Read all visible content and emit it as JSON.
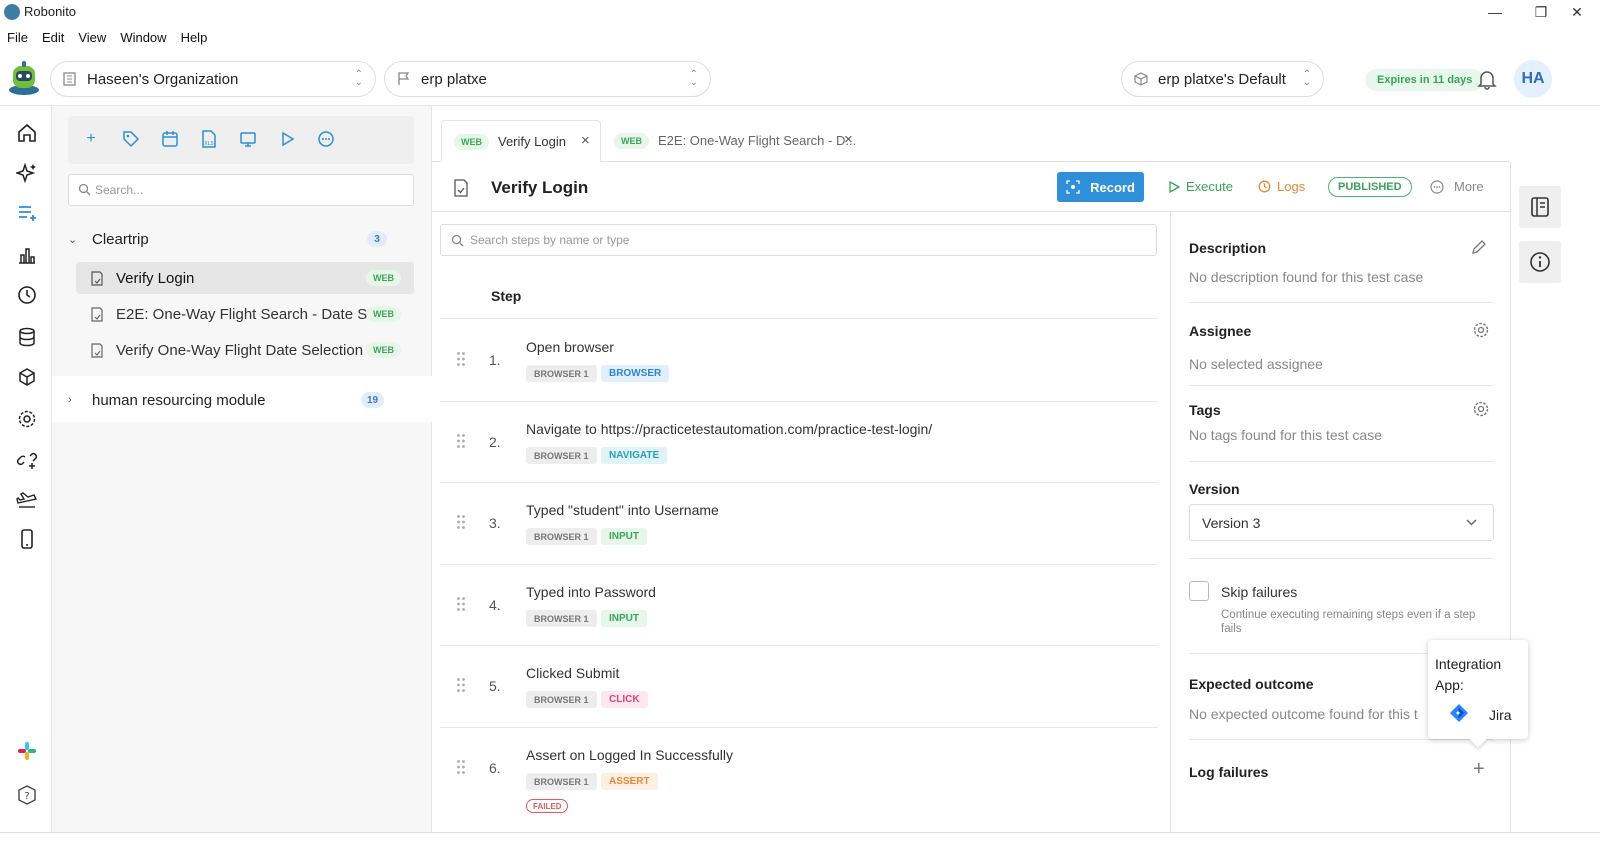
{
  "window": {
    "title": "Robonito",
    "minimize": "—",
    "maximize": "❐",
    "close": "✕"
  },
  "menu": [
    "File",
    "Edit",
    "View",
    "Window",
    "Help"
  ],
  "header": {
    "organization": "Haseen's Organization",
    "project": "erp platxe",
    "environment": "erp platxe's Default",
    "expires": "Expires in 11 days",
    "avatar": "HA"
  },
  "rail_icons": [
    "home-icon",
    "sparkle-icon",
    "test-cases-icon",
    "chart-icon",
    "clock-icon",
    "database-icon",
    "cube-icon",
    "settings-icon",
    "integrations-icon",
    "plane-icon",
    "mobile-icon",
    "slack-icon",
    "help-icon"
  ],
  "tree": {
    "search_placeholder": "Search...",
    "toolbar_icons": [
      "plus-icon",
      "tag-icon",
      "calendar-icon",
      "file-xls-icon",
      "monitor-icon",
      "play-icon",
      "more-icon"
    ],
    "groups": [
      {
        "name": "Cleartrip",
        "count": "3",
        "expanded": true,
        "items": [
          {
            "name": "Verify Login",
            "tag": "WEB",
            "selected": true
          },
          {
            "name": "E2E: One-Way Flight Search - Date S...",
            "tag": "WEB",
            "selected": false
          },
          {
            "name": "Verify One-Way Flight Date Selection",
            "tag": "WEB",
            "selected": false
          }
        ]
      },
      {
        "name": "human resourcing module",
        "count": "19",
        "expanded": false
      }
    ]
  },
  "tabs": [
    {
      "tag": "WEB",
      "label": "Verify Login",
      "active": true
    },
    {
      "tag": "WEB",
      "label": "E2E: One-Way Flight Search - D...",
      "active": false
    }
  ],
  "test_case": {
    "title": "Verify Login",
    "record": "Record",
    "execute": "Execute",
    "logs": "Logs",
    "status": "PUBLISHED",
    "more": "More"
  },
  "steps": {
    "search_placeholder": "Search steps by name or type",
    "header": "Step",
    "items": [
      {
        "num": "1.",
        "title": "Open browser",
        "browser": "BROWSER 1",
        "kind": "BROWSER",
        "kind_bg": "#e1f0fc",
        "kind_fg": "#2f86cf"
      },
      {
        "num": "2.",
        "title": "Navigate to https://practicetestautomation.com/practice-test-login/",
        "browser": "BROWSER 1",
        "kind": "NAVIGATE",
        "kind_bg": "#e0f4f7",
        "kind_fg": "#2aa0b3"
      },
      {
        "num": "3.",
        "title": "Typed \"student\" into Username",
        "browser": "BROWSER 1",
        "kind": "INPUT",
        "kind_bg": "#e6f6e9",
        "kind_fg": "#3aa35b"
      },
      {
        "num": "4.",
        "title": "Typed into Password",
        "browser": "BROWSER 1",
        "kind": "INPUT",
        "kind_bg": "#e6f6e9",
        "kind_fg": "#3aa35b"
      },
      {
        "num": "5.",
        "title": "Clicked Submit",
        "browser": "BROWSER 1",
        "kind": "CLICK",
        "kind_bg": "#fde8ef",
        "kind_fg": "#e0457b"
      },
      {
        "num": "6.",
        "title": "Assert on Logged In Successfully",
        "browser": "BROWSER 1",
        "kind": "ASSERT",
        "kind_bg": "#fdf0e2",
        "kind_fg": "#e8893a",
        "failed": "FAILED"
      }
    ]
  },
  "details": {
    "description_label": "Description",
    "description_value": "No description found for this test case",
    "assignee_label": "Assignee",
    "assignee_value": "No selected assignee",
    "tags_label": "Tags",
    "tags_value": "No tags found for this test case",
    "version_label": "Version",
    "version_value": "Version 3",
    "skip_label": "Skip failures",
    "skip_help": "Continue executing remaining steps even if a step fails",
    "skip_checked": false,
    "expected_label": "Expected outcome",
    "expected_value": "No expected outcome found for this t",
    "log_failures_label": "Log failures"
  },
  "popover": {
    "title": "Integration App:",
    "app": "Jira"
  },
  "colors": {
    "accent": "#2f8fd8",
    "success": "#3aa35b",
    "danger": "#e05b5b"
  }
}
